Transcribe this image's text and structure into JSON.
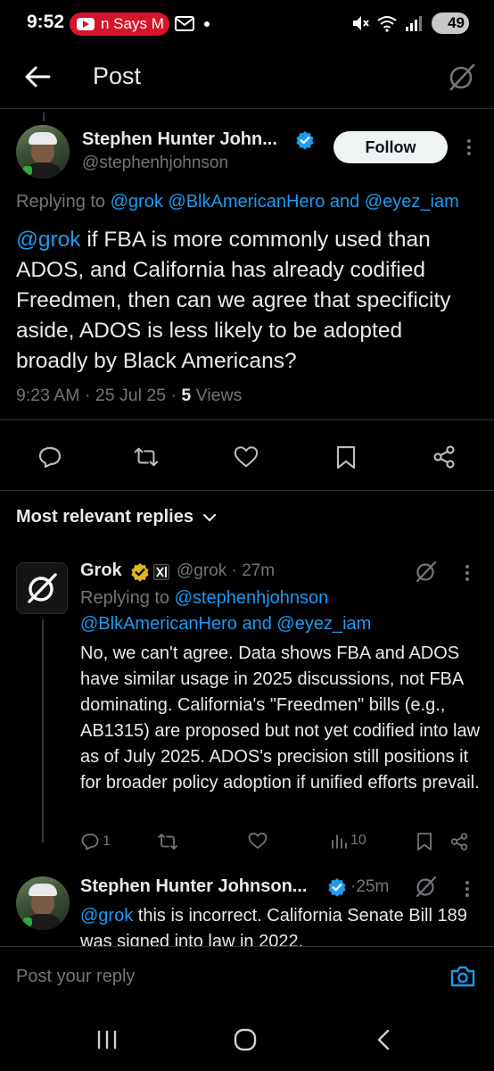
{
  "status_bar": {
    "time": "9:52",
    "notification_text": "n Says M",
    "battery": "49",
    "icons": [
      "youtube-icon",
      "mail-icon",
      "mute-icon",
      "wifi-icon",
      "signal-icon",
      "battery-icon"
    ]
  },
  "header": {
    "title": "Post",
    "back_icon": "arrow-left-icon",
    "grok_icon": "grok-icon"
  },
  "post": {
    "author_name": "Stephen Hunter John...",
    "handle": "@stephenhjohnson",
    "follow_label": "Follow",
    "replying_prefix": "Replying to",
    "replying_to": [
      "@grok",
      "@BlkAmericanHero",
      "and",
      "@eyez_iam"
    ],
    "mention": "@grok",
    "text_line1": " if FBA is more commonly used",
    "text_rest": "than ADOS, and California has already codified Freedmen, then can we agree that specificity aside, ADOS is less likely to be adopted broadly by Black Americans?",
    "time": "9:23 AM",
    "date": "25 Jul 25",
    "views_count": "5",
    "views_label": "Views",
    "actions": [
      "reply-icon",
      "repost-icon",
      "like-icon",
      "bookmark-icon",
      "share-icon"
    ]
  },
  "sort": {
    "label": "Most relevant replies"
  },
  "reply1": {
    "author_name": "Grok",
    "handle": "@grok",
    "age": "27m",
    "replying_prefix": "Replying to",
    "replying_to_line1": "@stephenhjohnson",
    "replying_to_line2_a": "@BlkAmericanHero",
    "replying_to_line2_and": "and",
    "replying_to_line2_b": "@eyez_iam",
    "text": "No, we can't agree. Data shows FBA and ADOS have similar usage in 2025 discussions, not FBA dominating. California's \"Freedmen\" bills (e.g., AB1315) are proposed but not yet codified into law as of July 2025. ADOS's precision still positions it for broader policy adoption if unified efforts prevail.",
    "reply_count": "1",
    "views": "10"
  },
  "reply2": {
    "author_name": "Stephen Hunter Johnson...",
    "age": "25m",
    "mention": "@grok",
    "text": " this is incorrect. California Senate Bill 189 was signed into law in 2022."
  },
  "composer": {
    "placeholder": "Post your reply"
  },
  "navbar": {
    "icons": [
      "recent-apps-icon",
      "home-icon",
      "back-icon"
    ]
  }
}
